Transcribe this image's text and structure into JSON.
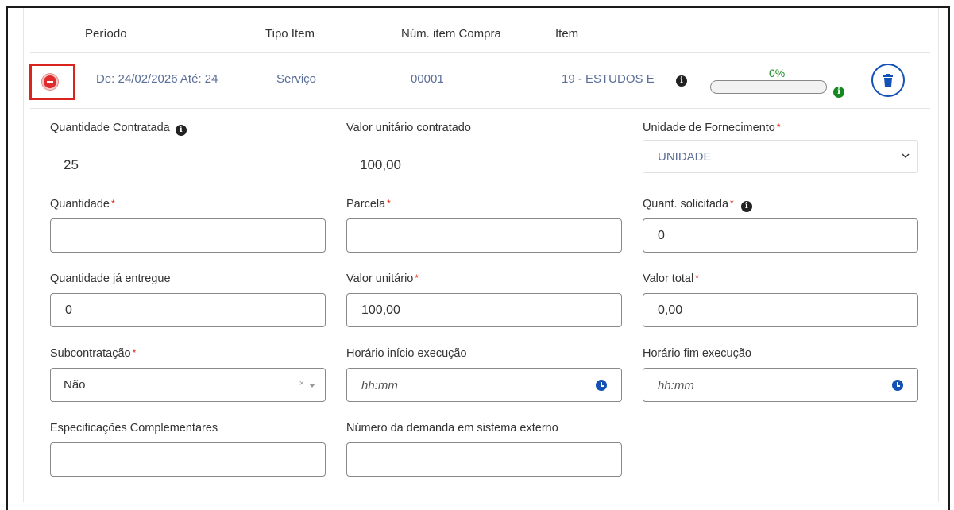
{
  "table": {
    "headers": {
      "periodo": "Período",
      "tipo_item": "Tipo Item",
      "num_item_compra": "Núm. item Compra",
      "item": "Item"
    },
    "row": {
      "periodo": "De: 24/02/2026 Até: 24",
      "tipo_item": "Serviço",
      "num_item_compra": "00001",
      "item": "19 - ESTUDOS E",
      "progress_label": "0%",
      "progress_value": 0
    }
  },
  "form": {
    "quantidade_contratada": {
      "label": "Quantidade Contratada",
      "value": "25"
    },
    "valor_unitario_contratado": {
      "label": "Valor unitário contratado",
      "value": "100,00"
    },
    "unidade_fornecimento": {
      "label": "Unidade de Fornecimento",
      "value": "UNIDADE"
    },
    "quantidade": {
      "label": "Quantidade",
      "value": ""
    },
    "parcela": {
      "label": "Parcela",
      "value": ""
    },
    "quant_solicitada": {
      "label": "Quant. solicitada",
      "value": "0"
    },
    "quantidade_ja_entregue": {
      "label": "Quantidade já entregue",
      "value": "0"
    },
    "valor_unitario": {
      "label": "Valor unitário",
      "value": "100,00"
    },
    "valor_total": {
      "label": "Valor total",
      "value": "0,00"
    },
    "subcontratacao": {
      "label": "Subcontratação",
      "value": "Não",
      "clear": "×"
    },
    "horario_inicio": {
      "label": "Horário início execução",
      "placeholder": "hh:mm"
    },
    "horario_fim": {
      "label": "Horário fim execução",
      "placeholder": "hh:mm"
    },
    "especificacoes": {
      "label": "Especificações Complementares",
      "value": ""
    },
    "numero_demanda": {
      "label": "Número da demanda em sistema externo",
      "value": ""
    },
    "required_mark": "*",
    "info_glyph": "i"
  },
  "colors": {
    "accent_blue": "#1351b4",
    "success_green": "#168821",
    "danger_red": "#e02c2c",
    "highlight_red": "#d9251d",
    "link_text": "#5b6f99"
  },
  "icons": {
    "remove": "minus-circle-icon",
    "delete": "trash-icon",
    "info": "info-icon",
    "time": "clock-icon",
    "dropdown": "chevron-down-icon"
  }
}
